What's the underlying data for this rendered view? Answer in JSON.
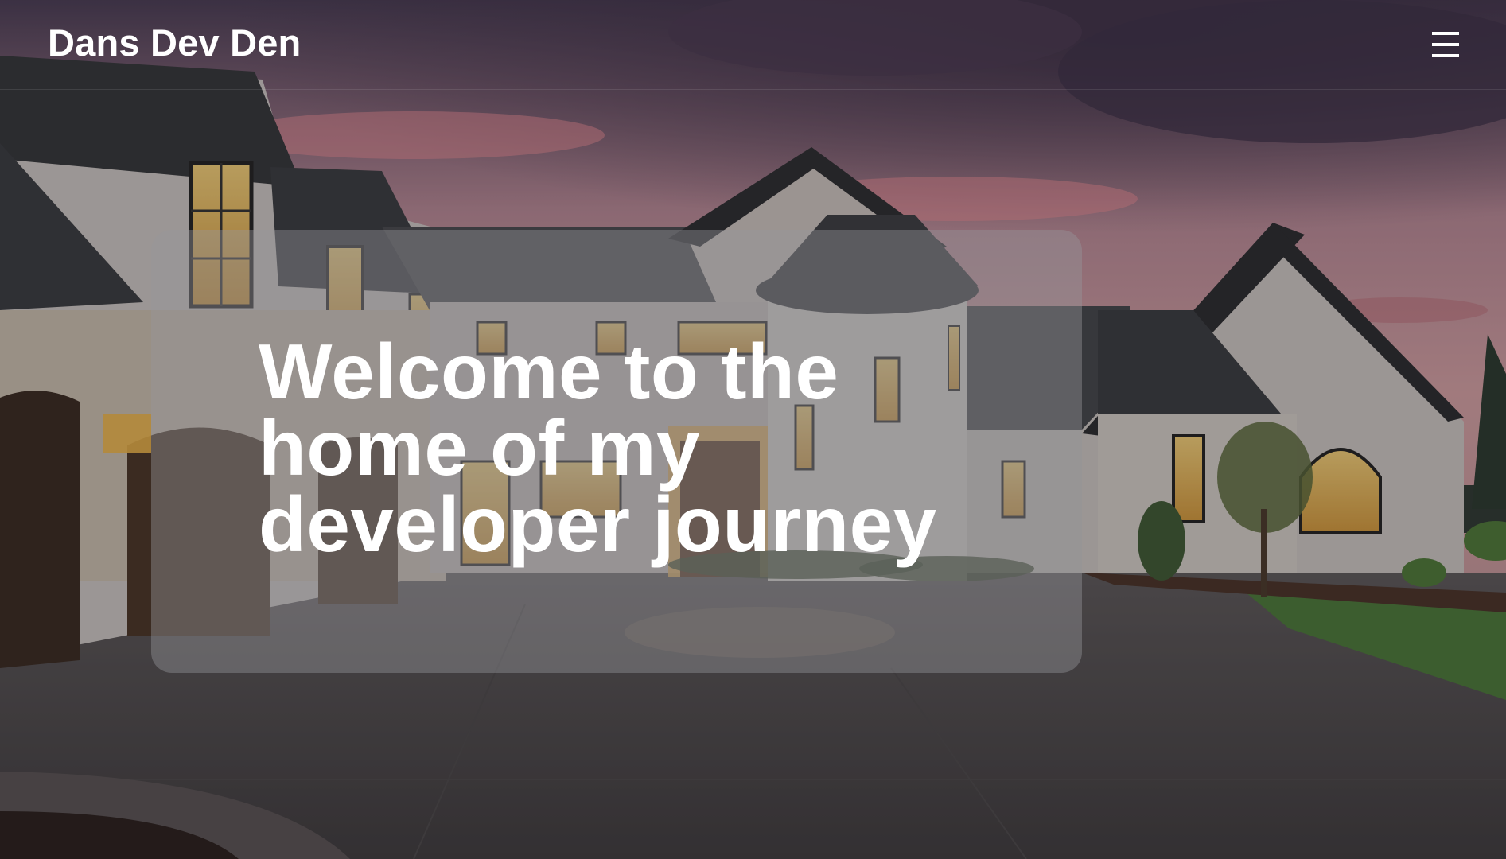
{
  "header": {
    "brand": "Dans Dev Den",
    "menu_icon": "hamburger-menu-icon"
  },
  "hero": {
    "title": "Welcome to the home of my developer journey",
    "background_image": "house-at-dusk-photo"
  },
  "colors": {
    "text": "#ffffff",
    "card": "rgba(150,150,155,0.42)",
    "sky_pink": "#e08a94",
    "sky_dark": "#3b3147"
  }
}
